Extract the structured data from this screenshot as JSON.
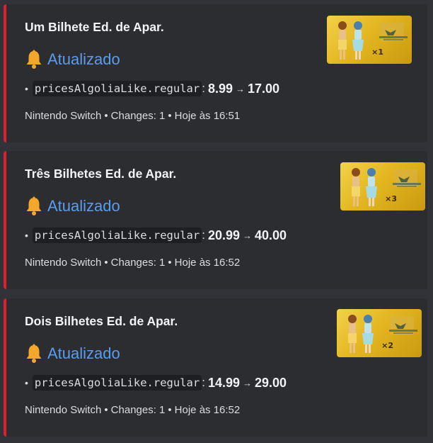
{
  "colors": {
    "accent_bar": "#e01e2e",
    "status_text": "#5b9bf0",
    "card_bg": "#2b2d31",
    "page_bg": "#313338"
  },
  "cards": [
    {
      "title": "Um Bilhete Ed. de Apar.",
      "status_icon": "bell-icon",
      "status": "Atualizado",
      "bullet": "•",
      "field": "pricesAlgoliaLike.regular",
      "colon": ":",
      "old_price": "8.99",
      "arrow": "→",
      "new_price": "17.00",
      "platform": "Nintendo Switch",
      "changes": "Changes: 1",
      "time": "Hoje às 16:51",
      "thumb_count": "×1"
    },
    {
      "title": "Três Bilhetes Ed. de Apar.",
      "status_icon": "bell-icon",
      "status": "Atualizado",
      "bullet": "•",
      "field": "pricesAlgoliaLike.regular",
      "colon": ":",
      "old_price": "20.99",
      "arrow": "→",
      "new_price": "40.00",
      "platform": "Nintendo Switch",
      "changes": "Changes: 1",
      "time": "Hoje às 16:52",
      "thumb_count": "×3"
    },
    {
      "title": "Dois Bilhetes Ed. de Apar.",
      "status_icon": "bell-icon",
      "status": "Atualizado",
      "bullet": "•",
      "field": "pricesAlgoliaLike.regular",
      "colon": ":",
      "old_price": "14.99",
      "arrow": "→",
      "new_price": "29.00",
      "platform": "Nintendo Switch",
      "changes": "Changes: 1",
      "time": "Hoje às 16:52",
      "thumb_count": "×2"
    }
  ],
  "separator": "•"
}
